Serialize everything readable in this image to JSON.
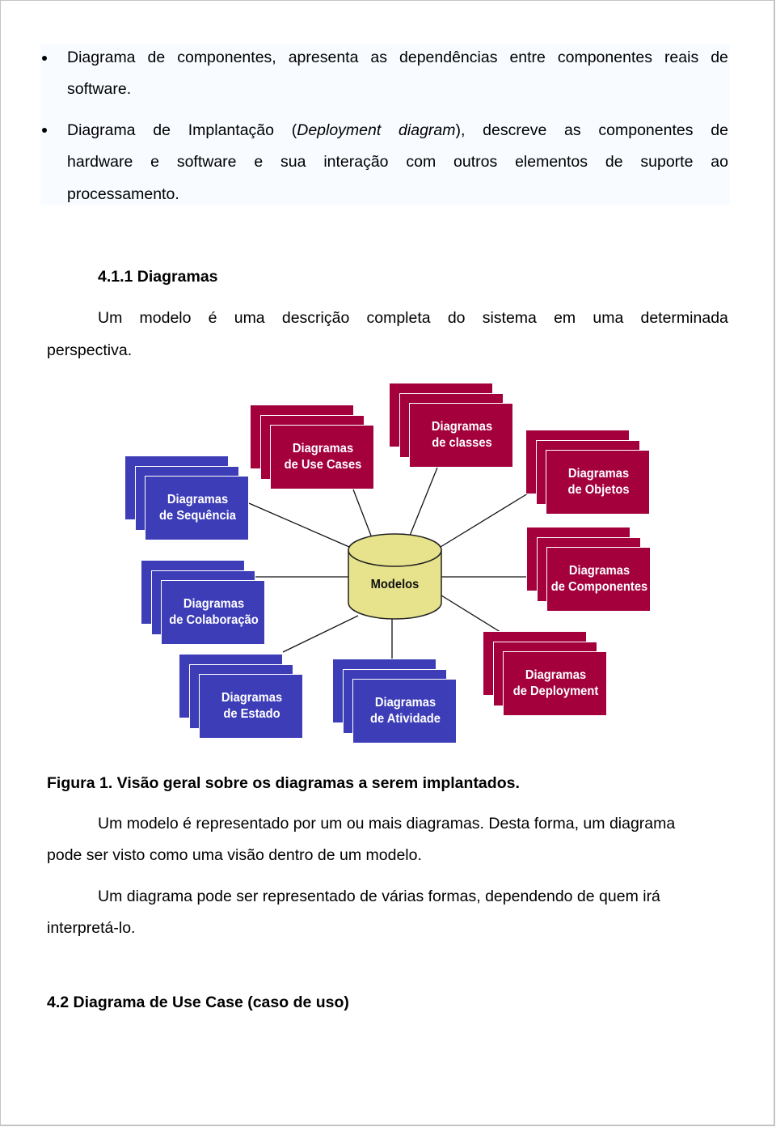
{
  "bullets": [
    {
      "lines": [
        [
          "Diagrama",
          "de",
          "componentes,",
          "apresenta",
          "as",
          "dependências",
          "entre",
          "componentes",
          "reais",
          "de"
        ],
        [
          "software."
        ]
      ]
    },
    {
      "line1_pre": "Diagrama de Implantação (",
      "line1_italic": "Deployment diagram",
      "line1_post": "), descreve as componentes de",
      "line1_words": [
        "Diagrama",
        "de",
        "Implantação",
        "(Deployment",
        "diagram),",
        "descreve",
        "as",
        "componentes",
        "de"
      ],
      "line2_words": [
        "hardware",
        "e",
        "software",
        "e",
        "sua",
        "interação",
        "com",
        "outros",
        "elementos",
        "de",
        "suporte",
        "ao"
      ],
      "line3": "processamento."
    }
  ],
  "section_411": {
    "heading": "4.1.1 Diagramas",
    "paragraph_line1_words": [
      "Um",
      "modelo",
      "é",
      "uma",
      "descrição",
      "completa",
      "do",
      "sistema",
      "em",
      "uma",
      "determinada"
    ],
    "paragraph_line2": "perspectiva."
  },
  "diagram": {
    "center": {
      "label": "Modelos",
      "shape": "cylinder",
      "color": "#e6e38c"
    },
    "colors": {
      "blue": "#3d3db8",
      "red": "#a3003c"
    },
    "nodes": [
      {
        "id": "sequencia",
        "line1": "Diagramas",
        "line2": "de Sequência",
        "color": "blue"
      },
      {
        "id": "use-cases",
        "line1": "Diagramas",
        "line2": "de Use Cases",
        "color": "red"
      },
      {
        "id": "classes",
        "line1": "Diagramas",
        "line2": "de classes",
        "color": "red"
      },
      {
        "id": "objetos",
        "line1": "Diagramas",
        "line2": "de Objetos",
        "color": "red"
      },
      {
        "id": "componentes",
        "line1": "Diagramas",
        "line2": "de Componentes",
        "color": "red"
      },
      {
        "id": "deployment",
        "line1": "Diagramas",
        "line2": "de Deployment",
        "color": "red"
      },
      {
        "id": "atividade",
        "line1": "Diagramas",
        "line2": "de Atividade",
        "color": "blue"
      },
      {
        "id": "estado",
        "line1": "Diagramas",
        "line2": "de Estado",
        "color": "blue"
      },
      {
        "id": "colaboracao",
        "line1": "Diagramas",
        "line2": "de Colaboração",
        "color": "blue"
      }
    ]
  },
  "figure_caption": "Figura 1. Visão geral sobre os diagramas a serem implantados.",
  "paragraph2": {
    "line1": "Um modelo é representado por um ou mais diagramas. Desta forma, um diagrama",
    "line2": "pode ser visto como uma visão dentro de um modelo."
  },
  "paragraph3": {
    "line1": "Um diagrama pode ser representado de várias formas, dependendo de quem irá",
    "line2": "interpretá-lo."
  },
  "section_42": {
    "heading": "4.2 Diagrama de Use Case (caso de uso)"
  }
}
